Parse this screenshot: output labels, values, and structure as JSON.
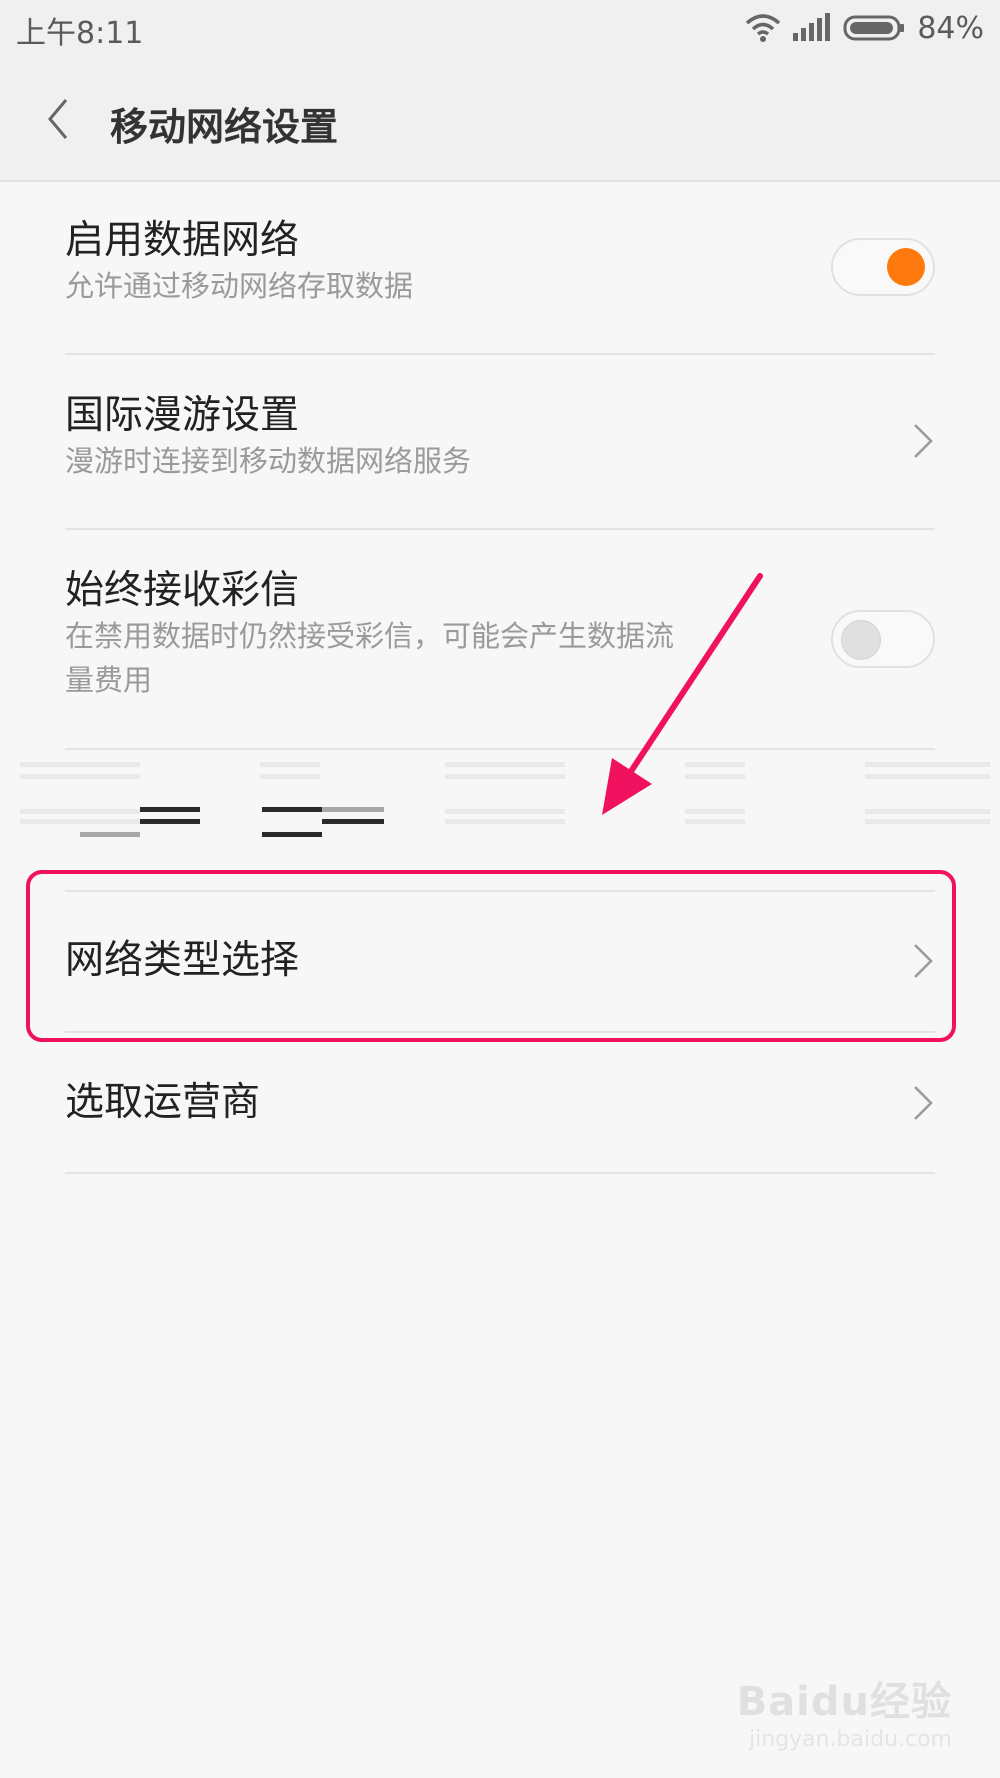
{
  "status_bar": {
    "time": "上午8:11",
    "battery": "84%"
  },
  "header": {
    "title": "移动网络设置"
  },
  "settings": [
    {
      "title": "启用数据网络",
      "subtitle": "允许通过移动网络存取数据",
      "control": "toggle",
      "state": "on"
    },
    {
      "title": "国际漫游设置",
      "subtitle": "漫游时连接到移动数据网络服务",
      "control": "chevron"
    },
    {
      "title": "始终接收彩信",
      "subtitle_line1": "在禁用数据时仍然接受彩信，可能会产生数据流",
      "subtitle_line2": "量费用",
      "control": "toggle",
      "state": "off"
    },
    {
      "title": "网络类型选择",
      "control": "chevron",
      "highlighted": true
    },
    {
      "title": "选取运营商",
      "control": "chevron"
    }
  ],
  "colors": {
    "toggle_on": "#ff7a0e",
    "annotation": "#f0125f"
  },
  "watermark": {
    "logo": "Baidu经验",
    "url": "jingyan.baidu.com"
  }
}
